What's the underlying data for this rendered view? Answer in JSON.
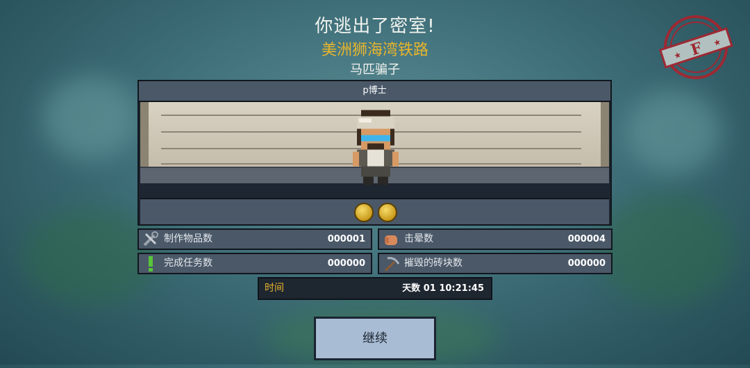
{
  "header": {
    "escape_msg": "你逃出了密室!",
    "prison_name": "美洲狮海湾铁路",
    "player_title": "马匹骗子"
  },
  "grade_stamp": {
    "letter": "F",
    "color": "#b0202a"
  },
  "character": {
    "name": "p博士"
  },
  "medals": [
    {
      "icon": "medal-icon"
    },
    {
      "icon": "fist-medal-icon"
    }
  ],
  "stats": {
    "crafted": {
      "label": "制作物品数",
      "value": "000001",
      "icon": "tools-icon"
    },
    "knockouts": {
      "label": "击晕数",
      "value": "000004",
      "icon": "fist-icon"
    },
    "quests": {
      "label": "完成任务数",
      "value": "000000",
      "icon": "exclamation-icon"
    },
    "bricks": {
      "label": "摧毁的砖块数",
      "value": "000000",
      "icon": "pickaxe-icon"
    }
  },
  "time": {
    "label": "时间",
    "value": "天数 01  10:21:45"
  },
  "continue_button": {
    "label": "继续"
  },
  "colors": {
    "accent_gold": "#e8b52c",
    "panel": "#4a5868",
    "button": "#a8bcd4"
  }
}
